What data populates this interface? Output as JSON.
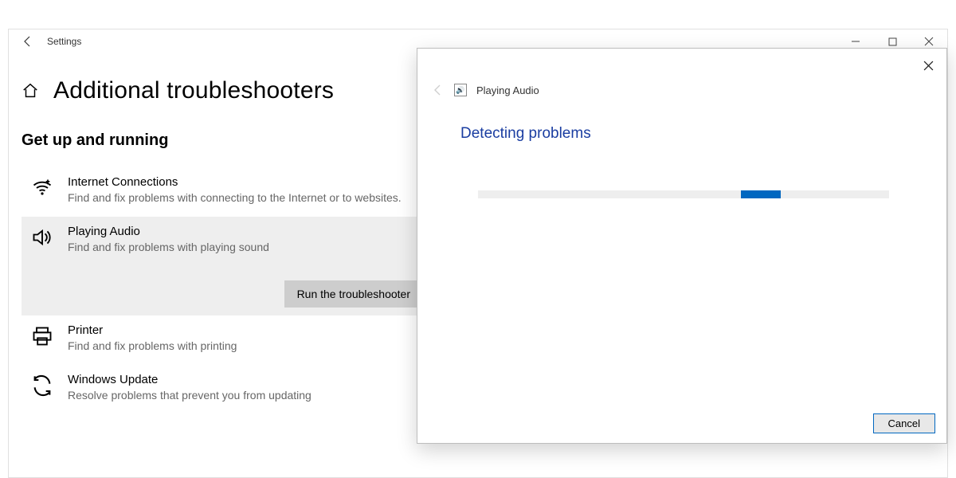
{
  "window": {
    "app_title": "Settings"
  },
  "page": {
    "title": "Additional troubleshooters",
    "section_heading": "Get up and running"
  },
  "troubleshooters": [
    {
      "title": "Internet Connections",
      "desc": "Find and fix problems with connecting to the Internet or to websites."
    },
    {
      "title": "Playing Audio",
      "desc": "Find and fix problems with playing sound"
    },
    {
      "title": "Printer",
      "desc": "Find and fix problems with printing"
    },
    {
      "title": "Windows Update",
      "desc": "Resolve problems that prevent you from updating"
    }
  ],
  "actions": {
    "run_troubleshooter": "Run the troubleshooter"
  },
  "dialog": {
    "title": "Playing Audio",
    "status": "Detecting problems",
    "cancel": "Cancel"
  },
  "colors": {
    "accent": "#0067c0",
    "link": "#1a3da1"
  }
}
